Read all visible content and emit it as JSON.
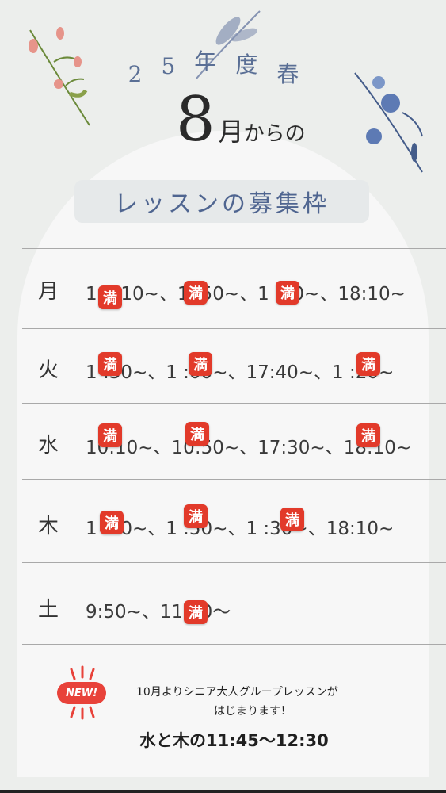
{
  "header": {
    "season_chars": [
      "2",
      "5",
      "年",
      "度",
      "春"
    ],
    "big_number": "8",
    "suffix_tsuki": "月",
    "suffix_rest": "からの",
    "pill_label": "レッスンの募集枠"
  },
  "full_mark": "満",
  "schedule": [
    {
      "day": "月",
      "times": "1 0:10~、1 :50~、1 :30~、18:10~"
    },
    {
      "day": "火",
      "times": "1 :30~、1 :00~、17:40~、1 :20~"
    },
    {
      "day": "水",
      "times": "10:10~、10:50~、17:30~、18:10~"
    },
    {
      "day": "木",
      "times": "1 :10~、1 :50~、1 :30~、18:10~"
    },
    {
      "day": "土",
      "times": "9:50~、11:10～"
    }
  ],
  "footer": {
    "new_badge": "NEW!",
    "note_line1": "10月よりシニア大人グループレッスンが",
    "note_line2": "はじまります！",
    "note_line3": "水と木の11:45～12:30"
  },
  "colors": {
    "background": "#eceeec",
    "panel": "#f7f7f7",
    "accent_blue": "#5a6f95",
    "stamp_red": "#e23a2a",
    "badge_red": "#e8423a"
  }
}
